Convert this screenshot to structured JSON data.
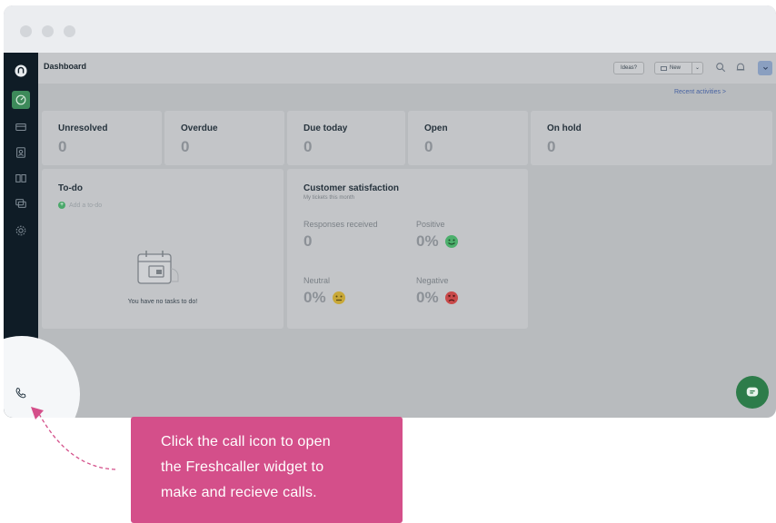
{
  "colors": {
    "sidebar": "#0f1c26",
    "accent_green": "#2d7c4a",
    "callout_pink": "#d44f8a",
    "link_blue": "#4863a2"
  },
  "header": {
    "title": "Dashboard",
    "ideas_label": "Ideas?",
    "new_label": "New",
    "icons": [
      "search-icon",
      "bell-icon",
      "avatar"
    ]
  },
  "sidebar": {
    "icons": [
      "logo-icon",
      "dashboard-icon",
      "tickets-icon",
      "contacts-icon",
      "solutions-icon",
      "forums-icon",
      "admin-icon",
      "phone-icon"
    ]
  },
  "recent_activities": "Recent activities >",
  "stats": [
    {
      "label": "Unresolved",
      "value": "0"
    },
    {
      "label": "Overdue",
      "value": "0"
    },
    {
      "label": "Due today",
      "value": "0"
    },
    {
      "label": "Open",
      "value": "0"
    },
    {
      "label": "On hold",
      "value": "0"
    }
  ],
  "todo": {
    "title": "To-do",
    "add_label": "Add a to-do",
    "empty_message": "You have no tasks to do!"
  },
  "csat": {
    "title": "Customer satisfaction",
    "subtitle": "My tickets this month",
    "responses_label": "Responses received",
    "responses_value": "0",
    "positive_label": "Positive",
    "positive_value": "0%",
    "neutral_label": "Neutral",
    "neutral_value": "0%",
    "negative_label": "Negative",
    "negative_value": "0%"
  },
  "callout": {
    "line1": "Click the call icon to open",
    "line2": "the Freshcaller widget to",
    "line3": "make and recieve calls."
  }
}
